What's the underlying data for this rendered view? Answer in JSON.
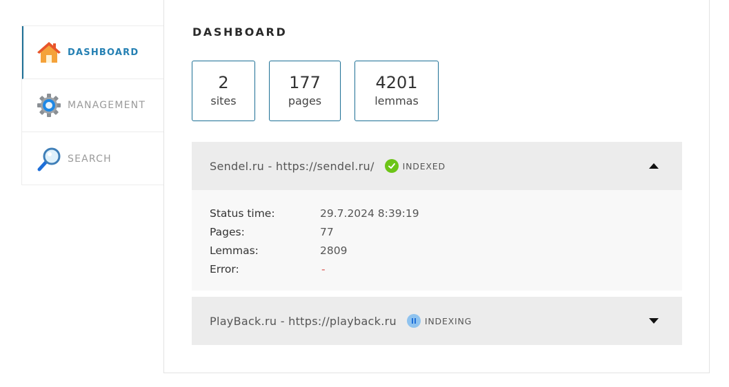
{
  "sidebar": {
    "items": [
      {
        "label": "DASHBOARD",
        "icon": "home-icon",
        "active": true
      },
      {
        "label": "MANAGEMENT",
        "icon": "gear-icon",
        "active": false
      },
      {
        "label": "SEARCH",
        "icon": "magnifier-icon",
        "active": false
      }
    ]
  },
  "page": {
    "title": "DASHBOARD"
  },
  "stats": {
    "sites": {
      "value": "2",
      "label": "sites"
    },
    "pages": {
      "value": "177",
      "label": "pages"
    },
    "lemmas": {
      "value": "4201",
      "label": "lemmas"
    }
  },
  "sites": [
    {
      "name": "Sendel.ru - https://sendel.ru/",
      "status": "INDEXED",
      "status_icon": "check-icon",
      "status_color": "#6cc417",
      "expanded": true,
      "details": {
        "status_time_label": "Status time:",
        "status_time": "29.7.2024 8:39:19",
        "pages_label": "Pages:",
        "pages": "77",
        "lemmas_label": "Lemmas:",
        "lemmas": "2809",
        "error_label": "Error:",
        "error": "-"
      }
    },
    {
      "name": "PlayBack.ru - https://playback.ru",
      "status": "INDEXING",
      "status_icon": "pause-icon",
      "status_color": "#8fc3ef",
      "expanded": false
    }
  ],
  "colors": {
    "accent": "#1b6e94",
    "active_nav": "#2580b3",
    "error": "#d9534f"
  }
}
